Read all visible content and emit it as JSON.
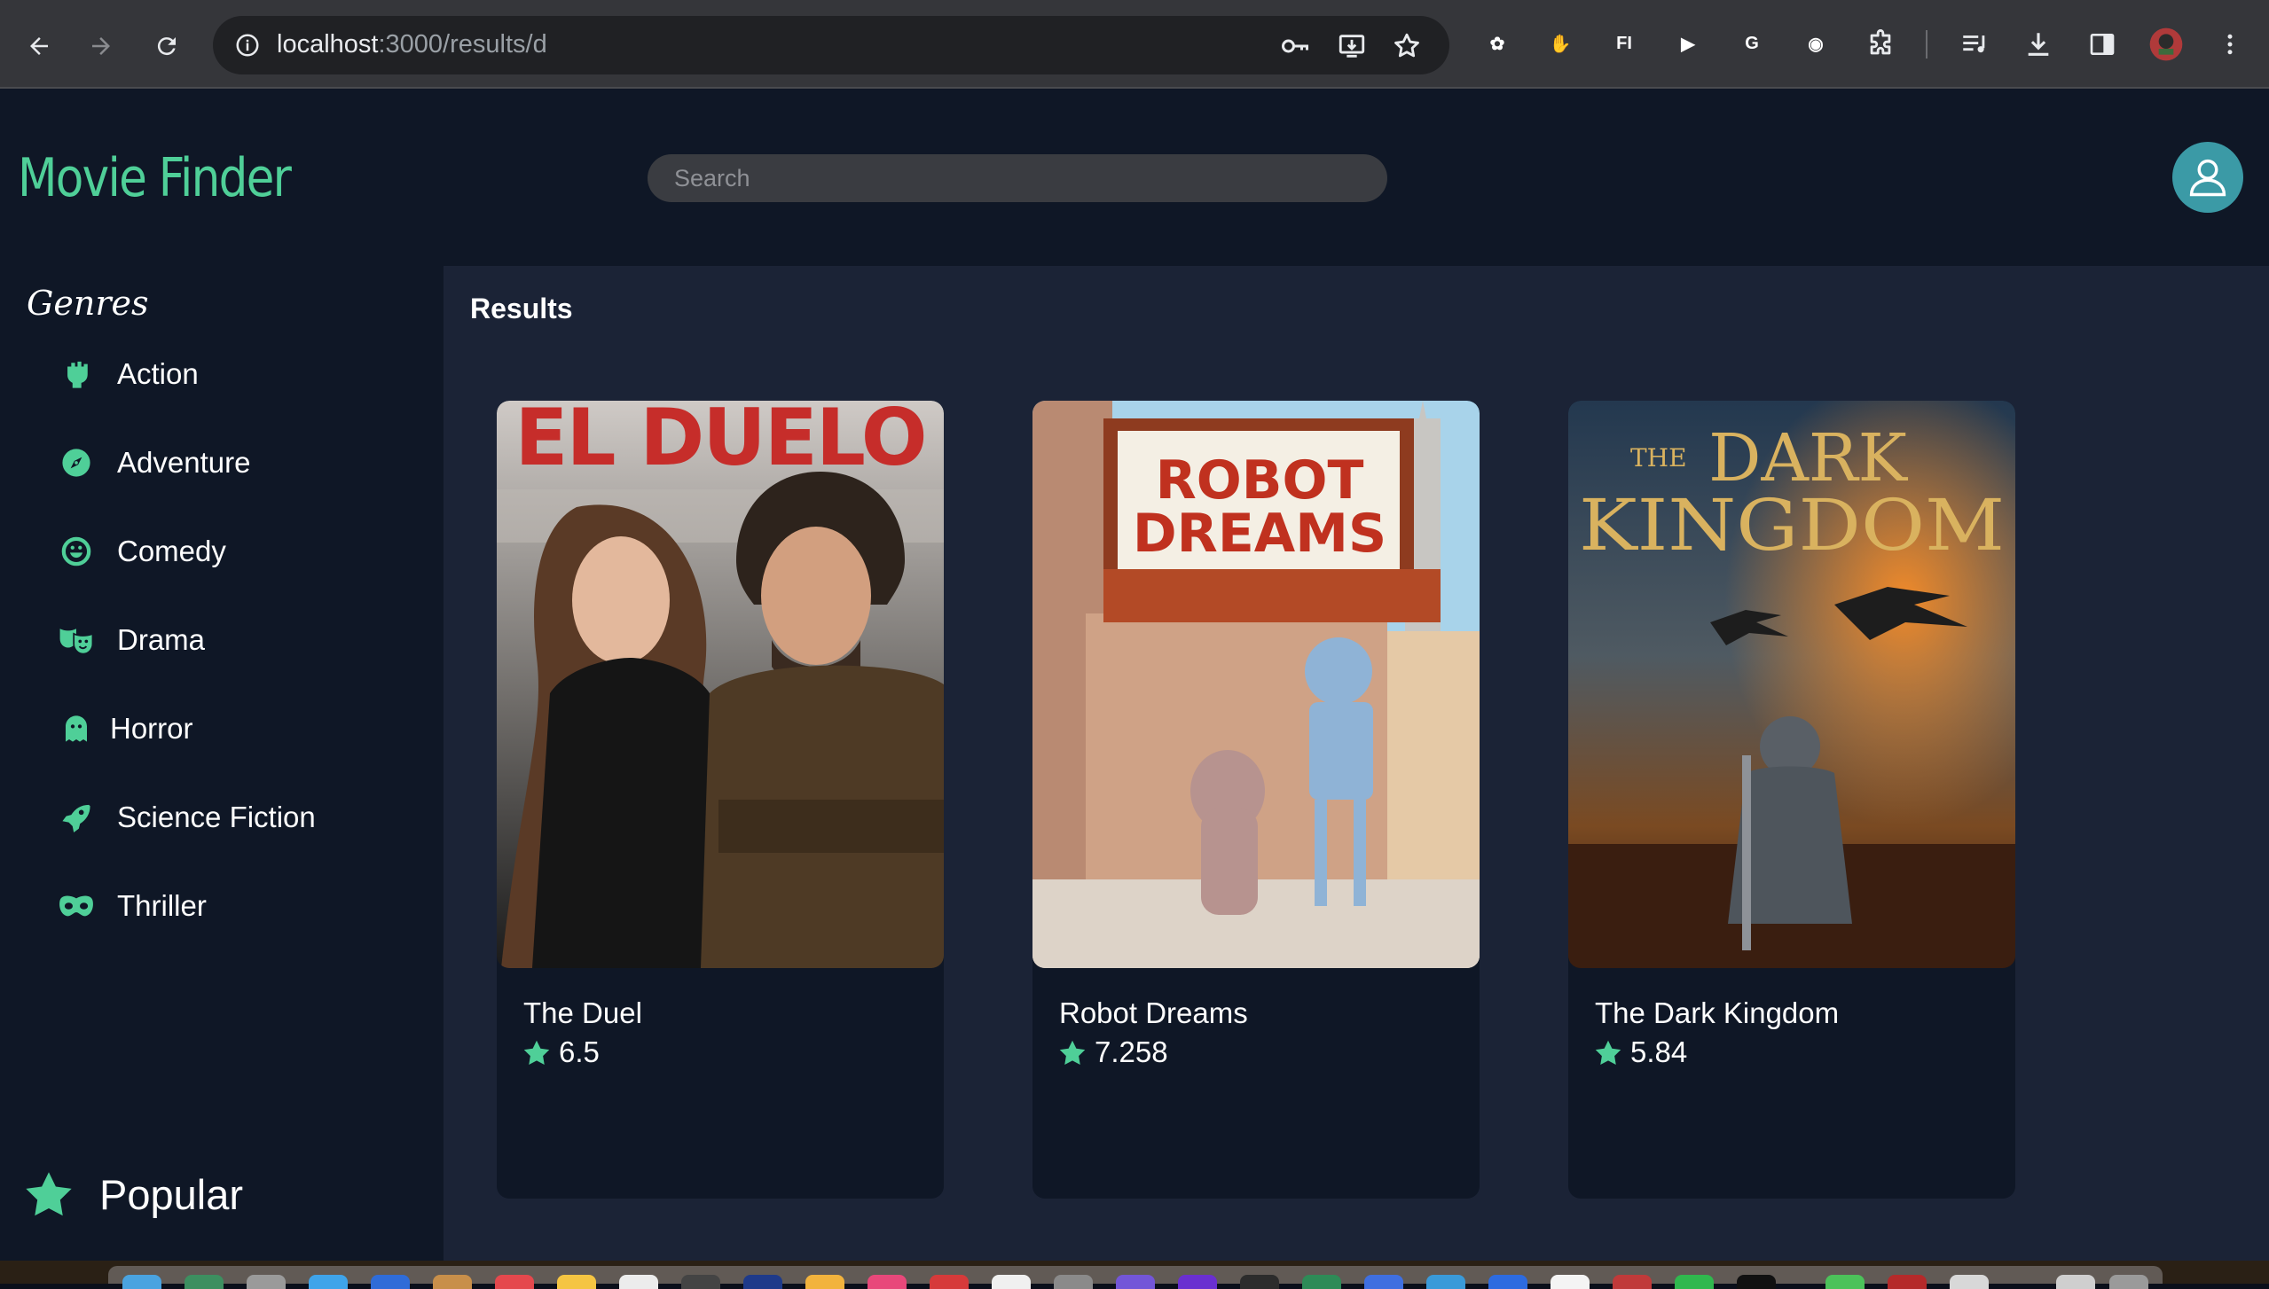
{
  "browser": {
    "url_host": "localhost",
    "url_path": ":3000/results/d",
    "extensions": [
      {
        "name": "paw-extension-icon",
        "color": "#c0392b",
        "glyph": "✿"
      },
      {
        "name": "hand-extension-icon",
        "color": "#e53935",
        "glyph": "✋"
      },
      {
        "name": "fi-extension-icon",
        "color": "#3f7fd6",
        "glyph": "FI"
      },
      {
        "name": "play-extension-icon",
        "color": "#d32f2f",
        "glyph": "▶"
      },
      {
        "name": "grammarly-extension-icon",
        "color": "#15a36b",
        "glyph": "G"
      },
      {
        "name": "color-extension-icon",
        "color": "#3b2d8f",
        "glyph": "◉"
      }
    ]
  },
  "app": {
    "brand": "Movie Finder",
    "search_placeholder": "Search"
  },
  "sidebar": {
    "title": "Genres",
    "genres": [
      {
        "label": "Action",
        "icon": "fist-icon"
      },
      {
        "label": "Adventure",
        "icon": "compass-icon"
      },
      {
        "label": "Comedy",
        "icon": "laugh-icon"
      },
      {
        "label": "Drama",
        "icon": "masks-icon"
      },
      {
        "label": "Horror",
        "icon": "ghost-icon"
      },
      {
        "label": "Science Fiction",
        "icon": "rocket-icon"
      },
      {
        "label": "Thriller",
        "icon": "mask-icon"
      }
    ],
    "popular_label": "Popular"
  },
  "results": {
    "title": "Results",
    "movies": [
      {
        "title": "The Duel",
        "rating": "6.5",
        "poster_text": "EL DUELO"
      },
      {
        "title": "Robot Dreams",
        "rating": "7.258",
        "poster_text_1": "ROBOT",
        "poster_text_2": "DREAMS"
      },
      {
        "title": "The Dark Kingdom",
        "rating": "5.84",
        "poster_text_small": "THE",
        "poster_text_1": "DARK",
        "poster_text_2": "KINGDOM"
      }
    ]
  },
  "colors": {
    "accent": "#4fcf98",
    "background": "#0f1726",
    "main_panel": "#1b2336"
  }
}
